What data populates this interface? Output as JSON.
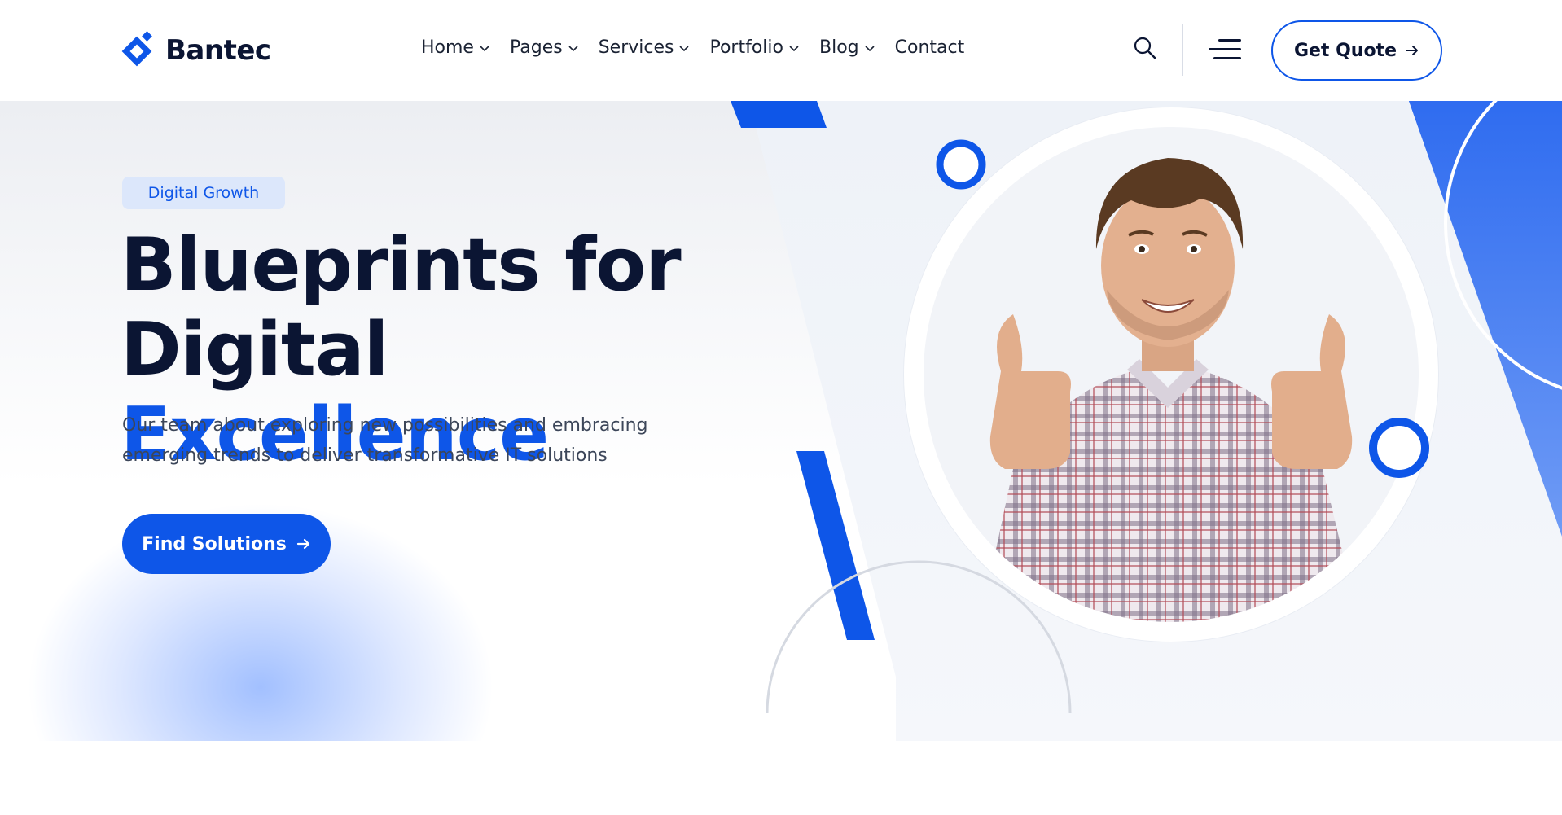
{
  "header": {
    "brand": "Bantec",
    "nav": [
      {
        "label": "Home",
        "has_dropdown": true
      },
      {
        "label": "Pages",
        "has_dropdown": true
      },
      {
        "label": "Services",
        "has_dropdown": true
      },
      {
        "label": "Portfolio",
        "has_dropdown": true
      },
      {
        "label": "Blog",
        "has_dropdown": true
      },
      {
        "label": "Contact",
        "has_dropdown": false
      }
    ],
    "search_icon": "search-icon",
    "menu_icon": "hamburger-menu-icon",
    "cta_label": "Get Quote"
  },
  "hero": {
    "badge": "Digital Growth",
    "title_line1": "Blueprints for",
    "title_line2_plain": "Digital",
    "title_line2_accent": "Excellence",
    "description": "Our team about exploring new possibilities and embracing emerging trends to deliver transformative IT solutions",
    "cta_label": "Find Solutions"
  },
  "colors": {
    "brand_blue": "#0e56e8",
    "dark_navy": "#0b1533",
    "badge_bg": "#dce7fb"
  }
}
